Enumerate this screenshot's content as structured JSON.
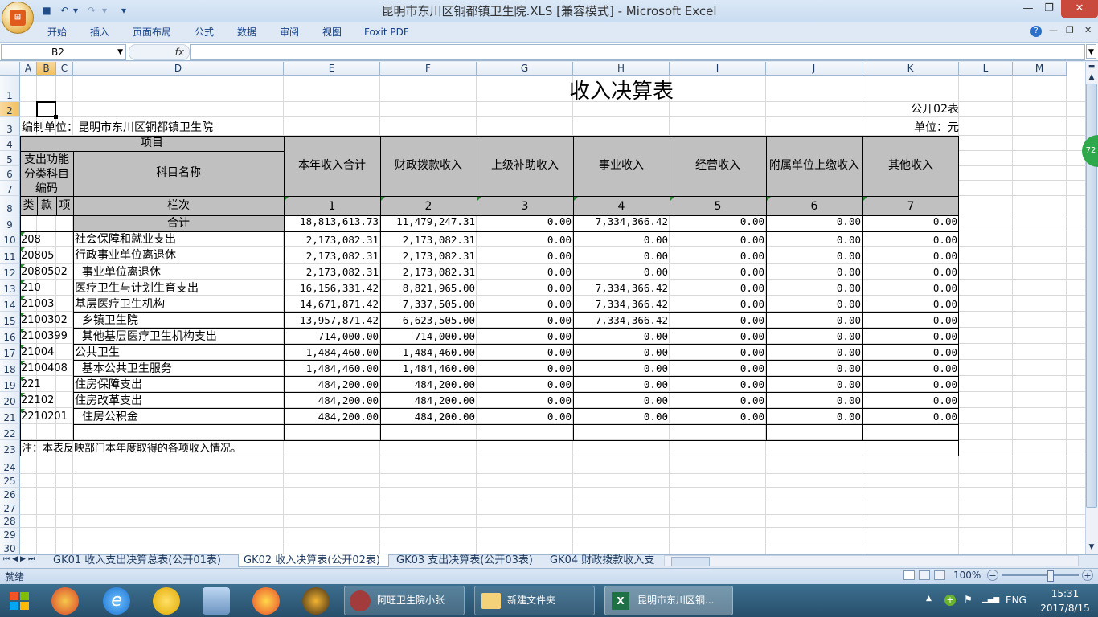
{
  "window": {
    "title": "昆明市东川区铜都镇卫生院.XLS  [兼容模式] - Microsoft Excel"
  },
  "ribbon": {
    "tabs": [
      "开始",
      "插入",
      "页面布局",
      "公式",
      "数据",
      "审阅",
      "视图",
      "Foxit PDF"
    ]
  },
  "formula_bar": {
    "name_box": "B2",
    "fx": "fx",
    "formula": ""
  },
  "columns": [
    "A",
    "B",
    "C",
    "D",
    "E",
    "F",
    "G",
    "H",
    "I",
    "J",
    "K",
    "L",
    "M"
  ],
  "rows": [
    "1",
    "2",
    "3",
    "4",
    "5",
    "6",
    "7",
    "8",
    "9",
    "10",
    "11",
    "12",
    "13",
    "14",
    "15",
    "16",
    "17",
    "18",
    "19",
    "20",
    "21",
    "22",
    "23",
    "24",
    "25",
    "26",
    "27",
    "28",
    "29",
    "30"
  ],
  "report": {
    "title": "收入决算表",
    "form_code": "公开02表",
    "unit_label": "编制单位：昆明市东川区铜都镇卫生院",
    "currency": "单位：元",
    "hdr_item": "项目",
    "hdr_code": "支出功能分类科目编码",
    "hdr_name": "科目名称",
    "hdr_lei": "类",
    "hdr_kuan": "款",
    "hdr_xiang": "项",
    "hdr_col_index": "栏次",
    "hdr_total_label": "合计",
    "columns": [
      {
        "label": "本年收入合计",
        "idx": "1"
      },
      {
        "label": "财政拨款收入",
        "idx": "2"
      },
      {
        "label": "上级补助收入",
        "idx": "3"
      },
      {
        "label": "事业收入",
        "idx": "4"
      },
      {
        "label": "经营收入",
        "idx": "5"
      },
      {
        "label": "附属单位上缴收入",
        "idx": "6"
      },
      {
        "label": "其他收入",
        "idx": "7"
      }
    ],
    "total_row": [
      "18,813,613.73",
      "11,479,247.31",
      "0.00",
      "7,334,366.42",
      "0.00",
      "0.00",
      "0.00"
    ],
    "data_rows": [
      {
        "code": "208",
        "name": "社会保障和就业支出",
        "vals": [
          "2,173,082.31",
          "2,173,082.31",
          "0.00",
          "0.00",
          "0.00",
          "0.00",
          "0.00"
        ]
      },
      {
        "code": "20805",
        "name": "行政事业单位离退休",
        "vals": [
          "2,173,082.31",
          "2,173,082.31",
          "0.00",
          "0.00",
          "0.00",
          "0.00",
          "0.00"
        ]
      },
      {
        "code": "2080502",
        "name": "  事业单位离退休",
        "vals": [
          "2,173,082.31",
          "2,173,082.31",
          "0.00",
          "0.00",
          "0.00",
          "0.00",
          "0.00"
        ]
      },
      {
        "code": "210",
        "name": "医疗卫生与计划生育支出",
        "vals": [
          "16,156,331.42",
          "8,821,965.00",
          "0.00",
          "7,334,366.42",
          "0.00",
          "0.00",
          "0.00"
        ]
      },
      {
        "code": "21003",
        "name": "基层医疗卫生机构",
        "vals": [
          "14,671,871.42",
          "7,337,505.00",
          "0.00",
          "7,334,366.42",
          "0.00",
          "0.00",
          "0.00"
        ]
      },
      {
        "code": "2100302",
        "name": "  乡镇卫生院",
        "vals": [
          "13,957,871.42",
          "6,623,505.00",
          "0.00",
          "7,334,366.42",
          "0.00",
          "0.00",
          "0.00"
        ]
      },
      {
        "code": "2100399",
        "name": "  其他基层医疗卫生机构支出",
        "vals": [
          "714,000.00",
          "714,000.00",
          "0.00",
          "0.00",
          "0.00",
          "0.00",
          "0.00"
        ]
      },
      {
        "code": "21004",
        "name": "公共卫生",
        "vals": [
          "1,484,460.00",
          "1,484,460.00",
          "0.00",
          "0.00",
          "0.00",
          "0.00",
          "0.00"
        ]
      },
      {
        "code": "2100408",
        "name": "  基本公共卫生服务",
        "vals": [
          "1,484,460.00",
          "1,484,460.00",
          "0.00",
          "0.00",
          "0.00",
          "0.00",
          "0.00"
        ]
      },
      {
        "code": "221",
        "name": "住房保障支出",
        "vals": [
          "484,200.00",
          "484,200.00",
          "0.00",
          "0.00",
          "0.00",
          "0.00",
          "0.00"
        ]
      },
      {
        "code": "22102",
        "name": "住房改革支出",
        "vals": [
          "484,200.00",
          "484,200.00",
          "0.00",
          "0.00",
          "0.00",
          "0.00",
          "0.00"
        ]
      },
      {
        "code": "2210201",
        "name": "  住房公积金",
        "vals": [
          "484,200.00",
          "484,200.00",
          "0.00",
          "0.00",
          "0.00",
          "0.00",
          "0.00"
        ]
      }
    ],
    "note": "注：本表反映部门本年度取得的各项收入情况。"
  },
  "sheet_tabs": [
    "GK01 收入支出决算总表(公开01表)",
    "GK02 收入决算表(公开02表)",
    "GK03 支出决算表(公开03表)",
    "GK04 财政拨款收入支"
  ],
  "active_sheet_index": 1,
  "status": {
    "ready": "就绪",
    "zoom": "100%",
    "zoom_level_percent": 100
  },
  "side_badge": "72",
  "taskbar": {
    "tasks": [
      "阿旺卫生院小张",
      "新建文件夹",
      "昆明市东川区铜..."
    ],
    "lang": "ENG",
    "time": "15:31",
    "date": "2017/8/15"
  },
  "colors": {
    "accent": "#15428b",
    "header_fill": "#c0c0c0",
    "selected_header": "#f1c15f",
    "taskbar": "#2f5d7c"
  }
}
